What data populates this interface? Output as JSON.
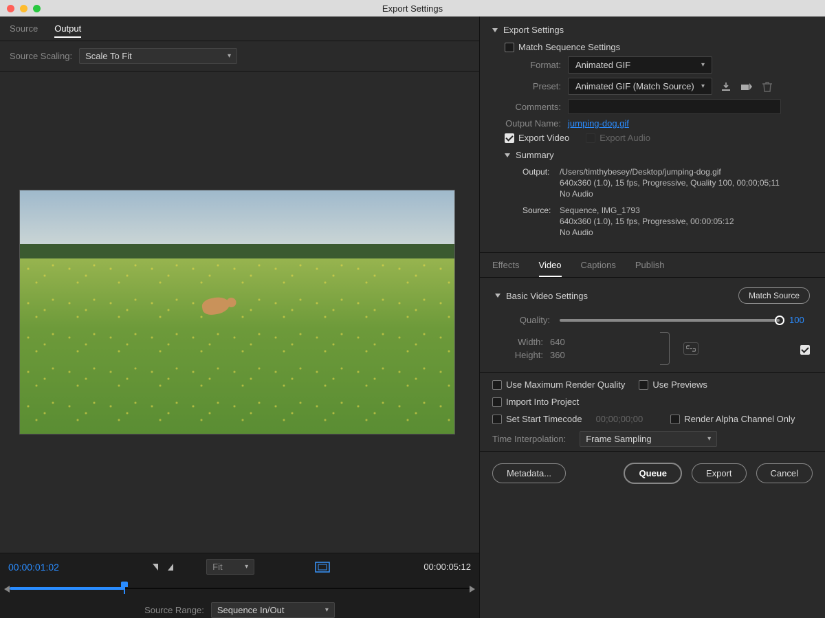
{
  "window": {
    "title": "Export Settings"
  },
  "left": {
    "tabs": {
      "source": "Source",
      "output": "Output"
    },
    "scale_label": "Source Scaling:",
    "scale_value": "Scale To Fit",
    "fit_label": "Fit",
    "timecode_current": "00:00:01:02",
    "timecode_total": "00:00:05:12",
    "source_range_label": "Source Range:",
    "source_range_value": "Sequence In/Out"
  },
  "export": {
    "section_title": "Export Settings",
    "match_sequence_label": "Match Sequence Settings",
    "format_label": "Format:",
    "format_value": "Animated GIF",
    "preset_label": "Preset:",
    "preset_value": "Animated GIF (Match Source)",
    "comments_label": "Comments:",
    "output_name_label": "Output Name:",
    "output_name_value": "jumping-dog.gif",
    "export_video_label": "Export Video",
    "export_audio_label": "Export Audio",
    "summary_title": "Summary",
    "summary_output_label": "Output:",
    "summary_output_path": "/Users/timthybesey/Desktop/jumping-dog.gif",
    "summary_output_spec": "640x360 (1.0), 15 fps, Progressive, Quality 100, 00;00;05;11",
    "summary_output_audio": "No Audio",
    "summary_source_label": "Source:",
    "summary_source_name": "Sequence, IMG_1793",
    "summary_source_spec": "640x360 (1.0), 15 fps, Progressive, 00:00:05:12",
    "summary_source_audio": "No Audio"
  },
  "rtabs": {
    "effects": "Effects",
    "video": "Video",
    "captions": "Captions",
    "publish": "Publish"
  },
  "video": {
    "section_title": "Basic Video Settings",
    "match_source_btn": "Match Source",
    "quality_label": "Quality:",
    "quality_value": "100",
    "width_label": "Width:",
    "width_value": "640",
    "height_label": "Height:",
    "height_value": "360"
  },
  "opts": {
    "max_render": "Use Maximum Render Quality",
    "use_previews": "Use Previews",
    "import_project": "Import Into Project",
    "set_start_tc": "Set Start Timecode",
    "start_tc_value": "00;00;00;00",
    "render_alpha": "Render Alpha Channel Only",
    "time_interp_label": "Time Interpolation:",
    "time_interp_value": "Frame Sampling"
  },
  "footer": {
    "metadata": "Metadata...",
    "queue": "Queue",
    "export": "Export",
    "cancel": "Cancel"
  }
}
